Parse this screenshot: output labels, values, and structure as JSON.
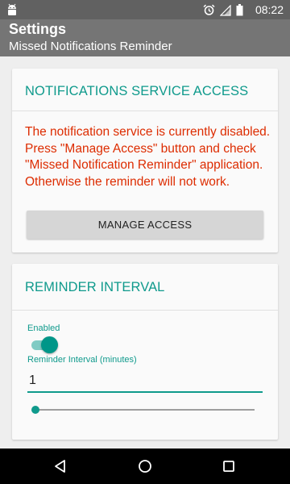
{
  "status_bar": {
    "time": "08:22",
    "icons": [
      "android-icon",
      "alarm-icon",
      "signal-icon",
      "battery-icon"
    ]
  },
  "app_bar": {
    "title": "Settings",
    "subtitle": "Missed Notifications Reminder"
  },
  "notifications_card": {
    "title": "NOTIFICATIONS SERVICE ACCESS",
    "warning": "The notification service is currently disabled. Press \"Manage Access\" button and check \"Missed Notification Reminder\" application. Otherwise the reminder will not work.",
    "button_label": "MANAGE ACCESS"
  },
  "reminder_card": {
    "title": "REMINDER INTERVAL",
    "enabled_label": "Enabled",
    "enabled": true,
    "interval_label": "Reminder Interval (minutes)",
    "interval_value": "1",
    "slider_value": 1
  },
  "colors": {
    "accent": "#0f9a8c",
    "warning": "#dd2c00",
    "app_bar": "#757575",
    "status_bar": "#616161"
  },
  "nav_bar": {
    "buttons": [
      "back-icon",
      "home-icon",
      "recent-apps-icon"
    ]
  }
}
